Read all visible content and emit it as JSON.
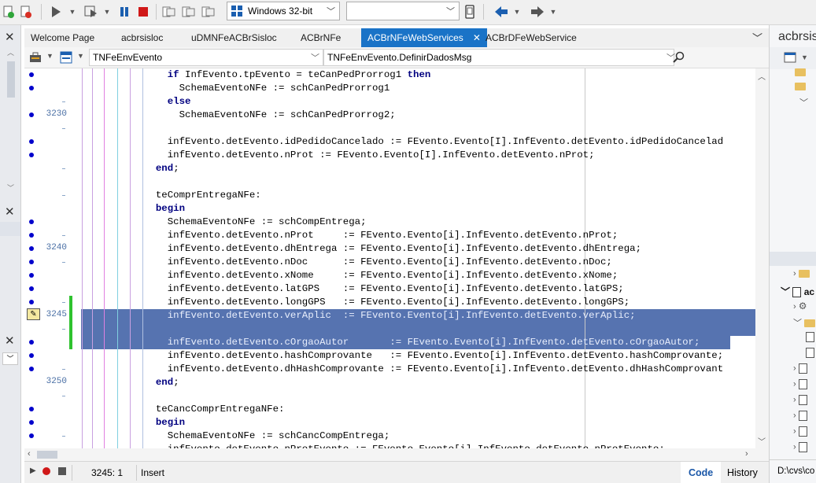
{
  "toolbar": {
    "platform": "Windows 32-bit",
    "config": "",
    "icons": [
      "new-file-icon",
      "close-project-icon",
      "run-icon",
      "run-without-debug-icon",
      "pause-icon",
      "stop-icon",
      "step-over-icon",
      "trace-into-icon",
      "run-to-cursor-icon",
      "device-icon",
      "back-icon",
      "forward-icon"
    ]
  },
  "tabs": [
    {
      "label": "Welcome Page",
      "active": false
    },
    {
      "label": "acbrsisloc",
      "active": false
    },
    {
      "label": "uDMNFeACBrSisloc",
      "active": false
    },
    {
      "label": "ACBrNFe",
      "active": false
    },
    {
      "label": "ACBrNFeWebServices",
      "active": true
    },
    {
      "label": "ACBrDFeWebService",
      "active": false
    }
  ],
  "nav": {
    "class_combo": "TNFeEnvEvento",
    "method_combo": "TNFeEnvEvento.DefinirDadosMsg"
  },
  "editor": {
    "lines": [
      {
        "num": "",
        "dot": true,
        "code": "    if InfEvento.tpEvento = teCanPedProrrog1 then"
      },
      {
        "num": "",
        "dot": true,
        "code": "      SchemaEventoNFe := schCanPedProrrog1"
      },
      {
        "num": "",
        "dot": false,
        "code": "    else"
      },
      {
        "num": "3230",
        "dot": true,
        "code": "      SchemaEventoNFe := schCanPedProrrog2;"
      },
      {
        "num": "",
        "dot": false,
        "code": ""
      },
      {
        "num": "",
        "dot": true,
        "code": "    infEvento.detEvento.idPedidoCancelado := FEvento.Evento[I].InfEvento.detEvento.idPedidoCancelad"
      },
      {
        "num": "",
        "dot": true,
        "code": "    infEvento.detEvento.nProt := FEvento.Evento[I].InfEvento.detEvento.nProt;"
      },
      {
        "num": "",
        "dot": false,
        "code": "  end;"
      },
      {
        "num": "",
        "dot": false,
        "code": ""
      },
      {
        "num": "",
        "dot": false,
        "code": "  teComprEntregaNFe:"
      },
      {
        "num": "",
        "dot": false,
        "code": "  begin"
      },
      {
        "num": "",
        "dot": true,
        "code": "    SchemaEventoNFe := schCompEntrega;"
      },
      {
        "num": "",
        "dot": true,
        "code": "    infEvento.detEvento.nProt     := FEvento.Evento[i].InfEvento.detEvento.nProt;"
      },
      {
        "num": "3240",
        "dot": true,
        "code": "    infEvento.detEvento.dhEntrega := FEvento.Evento[i].InfEvento.detEvento.dhEntrega;"
      },
      {
        "num": "",
        "dot": true,
        "code": "    infEvento.detEvento.nDoc      := FEvento.Evento[i].InfEvento.detEvento.nDoc;"
      },
      {
        "num": "",
        "dot": true,
        "code": "    infEvento.detEvento.xNome     := FEvento.Evento[i].InfEvento.detEvento.xNome;"
      },
      {
        "num": "",
        "dot": true,
        "code": "    infEvento.detEvento.latGPS    := FEvento.Evento[i].InfEvento.detEvento.latGPS;"
      },
      {
        "num": "",
        "dot": true,
        "code": "    infEvento.detEvento.longGPS   := FEvento.Evento[i].InfEvento.detEvento.longGPS;"
      },
      {
        "num": "3245",
        "dot": false,
        "code": "    infEvento.detEvento.verAplic  := FEvento.Evento[i].InfEvento.detEvento.verAplic;"
      },
      {
        "num": "",
        "dot": false,
        "code": ""
      },
      {
        "num": "",
        "dot": true,
        "code": "    infEvento.detEvento.cOrgaoAutor       := FEvento.Evento[i].InfEvento.detEvento.cOrgaoAutor;"
      },
      {
        "num": "",
        "dot": true,
        "code": "    infEvento.detEvento.hashComprovante   := FEvento.Evento[i].InfEvento.detEvento.hashComprovante;"
      },
      {
        "num": "",
        "dot": true,
        "code": "    infEvento.detEvento.dhHashComprovante := FEvento.Evento[i].InfEvento.detEvento.dhHashComprovant"
      },
      {
        "num": "3250",
        "dot": false,
        "code": "  end;"
      },
      {
        "num": "",
        "dot": false,
        "code": ""
      },
      {
        "num": "",
        "dot": true,
        "code": "  teCancComprEntregaNFe:"
      },
      {
        "num": "",
        "dot": true,
        "code": "  begin"
      },
      {
        "num": "",
        "dot": true,
        "code": "    SchemaEventoNFe := schCancCompEntrega;"
      },
      {
        "num": "",
        "dot": false,
        "code": "    infEvento.detEvento.nProtEvento := FEvento.Evento[i].InfEvento.detEvento.nProtEvento;"
      }
    ]
  },
  "status": {
    "position": "3245:  1",
    "mode": "Insert",
    "tab_code": "Code",
    "tab_history": "History"
  },
  "right_panel": {
    "title": "acbrsisloc",
    "item_label": "ac",
    "path": "D:\\cvs\\co"
  },
  "colors": {
    "active_tab": "#1a73c7",
    "selection": "#5673b0",
    "keyword": "#000080",
    "modified_bar": "#2fc22f"
  }
}
